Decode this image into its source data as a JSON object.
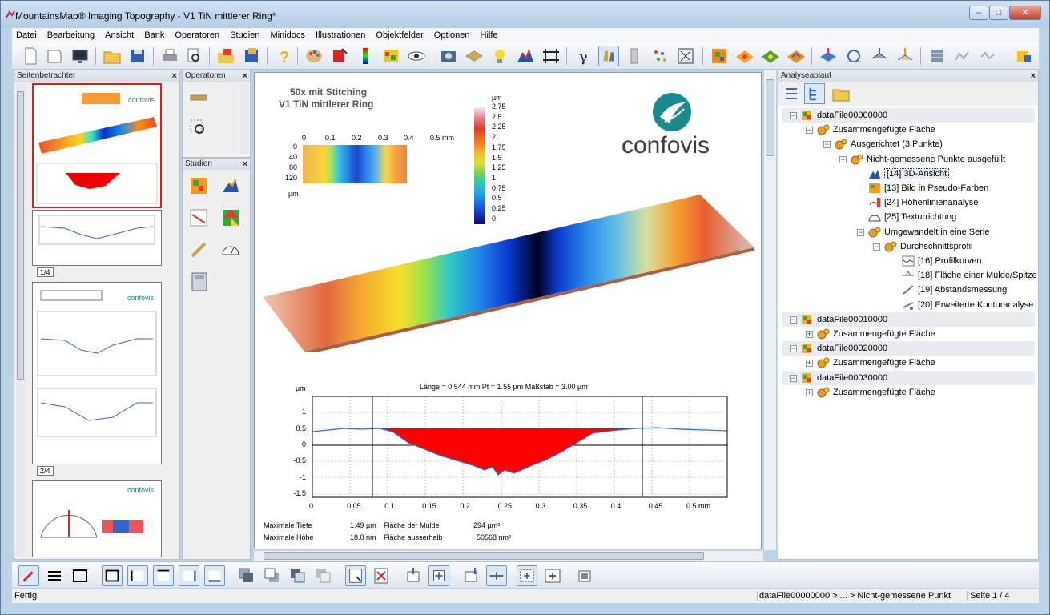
{
  "window": {
    "title": "MountainsMap® Imaging Topography - V1 TiN mittlerer Ring*",
    "buttons": {
      "minimize": "–",
      "maximize": "□",
      "close": "✕"
    }
  },
  "menu": [
    "Datei",
    "Bearbeitung",
    "Ansicht",
    "Bank",
    "Operatoren",
    "Studien",
    "Minidocs",
    "Illustrationen",
    "Objektfelder",
    "Optionen",
    "Hilfe"
  ],
  "panels": {
    "page_viewer": {
      "title": "Seitenbetrachter",
      "pages": [
        "1/4",
        "2/4"
      ]
    },
    "operators": {
      "title": "Operatoren"
    },
    "studies": {
      "title": "Studien"
    },
    "analysis": {
      "title": "Analyseablauf"
    }
  },
  "document": {
    "title_line1": "50x mit Stitching",
    "title_line2": "V1 TiN mittlerer Ring",
    "logo_text": "confovis",
    "map_axis": {
      "x_ticks": [
        "0",
        "0.1",
        "0.2",
        "0.3",
        "0.4",
        "0.5 mm"
      ],
      "y_ticks": [
        "0",
        "40",
        "80",
        "120"
      ],
      "y_unit": "µm"
    },
    "colorbar": {
      "unit": "µm",
      "labels": [
        "2.75",
        "2.5",
        "2.25",
        "2",
        "1.75",
        "1.5",
        "1.25",
        "1",
        "0.75",
        "0.5",
        "0.25",
        "0"
      ]
    },
    "profile": {
      "header": "Länge = 0.544 mm  Pt = 1.55 µm  Maßstab = 3.00 µm",
      "y_unit": "µm",
      "y_ticks": [
        "1",
        "0.5",
        "0",
        "-0.5",
        "-1",
        "-1.5"
      ],
      "x_ticks": [
        "0",
        "0.05",
        "0.1",
        "0.15",
        "0.2",
        "0.25",
        "0.3",
        "0.35",
        "0.4",
        "0.45",
        "0.5 mm"
      ]
    },
    "stats": [
      {
        "label": "Maximale Tiefe",
        "value": "1.49 µm",
        "label2": "Fläche der Mulde",
        "value2": "294 µm²"
      },
      {
        "label": "Maximale Höhe",
        "value": "18.0 nm",
        "label2": "Fläche ausserhalb",
        "value2": "50568 nm²"
      }
    ]
  },
  "tree": [
    {
      "label": "dataFile00000000",
      "level": 0
    },
    {
      "label": "Zusammengefügte Fläche",
      "level": 1
    },
    {
      "label": "Ausgerichtet (3 Punkte)",
      "level": 2
    },
    {
      "label": "Nicht-gemessene Punkte ausgefüllt",
      "level": 3
    },
    {
      "label": "[14] 3D-Ansicht",
      "level": 4,
      "selected": true
    },
    {
      "label": "[13] Bild in Pseudo-Farben",
      "level": 4
    },
    {
      "label": "[24] Höhenlinienanalyse",
      "level": 4
    },
    {
      "label": "[25] Texturrichtung",
      "level": 4
    },
    {
      "label": "Umgewandelt in eine Serie",
      "level": 4
    },
    {
      "label": "Durchschnittsprofil",
      "level": 5
    },
    {
      "label": "[16] Profilkurven",
      "level": 6
    },
    {
      "label": "[18] Fläche einer Mulde/Spitze",
      "level": 6
    },
    {
      "label": "[19] Abstandsmessung",
      "level": 6
    },
    {
      "label": "[20] Erweiterte Konturanalyse",
      "level": 6
    },
    {
      "label": "dataFile00010000",
      "level": 0
    },
    {
      "label": "Zusammengefügte Fläche",
      "level": 1
    },
    {
      "label": "dataFile00020000",
      "level": 0
    },
    {
      "label": "Zusammengefügte Fläche",
      "level": 1
    },
    {
      "label": "dataFile00030000",
      "level": 0
    },
    {
      "label": "Zusammengefügte Fläche",
      "level": 1
    }
  ],
  "status": {
    "left": "Fertig",
    "path": "dataFile00000000 > ... > Nicht-gemessene Punkt",
    "page": "Seite 1 / 4"
  },
  "colors": {
    "accent": "#1a8a8f",
    "profile_fill": "#ff0000",
    "page_highlight": "#d32020"
  }
}
